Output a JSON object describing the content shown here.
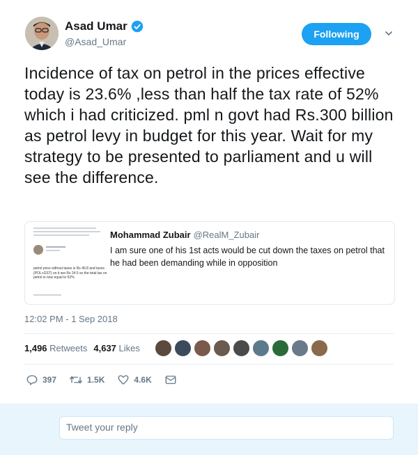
{
  "author": {
    "name": "Asad Umar",
    "handle": "@Asad_Umar",
    "verified": true,
    "follow_button_label": "Following"
  },
  "tweet": {
    "text": "Incidence of tax on petrol in the prices effective today is 23.6% ,less than half the tax rate of 52% which i had criticized.  pml n govt had Rs.300 billion as petrol levy in budget for this year. Wait for my strategy to be presented to parliament and u will see the difference.",
    "timestamp": "12:02 PM - 1 Sep 2018"
  },
  "quoted_tweet": {
    "author_name": "Mohammad Zubair",
    "author_handle": "@RealM_Zubair",
    "text": "I am sure one of his 1st acts would be cut down the taxes on petrol that he had been demanding while in opposition",
    "image_text": "petrol price without taxes is Rs 46.8 and taxes (POL+GST) on it are Rs 24.5 so the total tax on petrol is now equal to 52%"
  },
  "stats": {
    "retweets_count": "1,496",
    "retweets_label": "Retweets",
    "likes_count": "4,637",
    "likes_label": "Likes",
    "liker_colors": [
      "#5a4a3e",
      "#3b4a5c",
      "#7a5a4a",
      "#6b5a50",
      "#4a4a4a",
      "#5c7a8c",
      "#2b6b3a",
      "#6a7a8a",
      "#8a6a4a"
    ]
  },
  "actions": {
    "reply_count": "397",
    "retweet_count": "1.5K",
    "like_count": "4.6K"
  },
  "reply": {
    "placeholder": "Tweet your reply"
  },
  "colors": {
    "accent": "#1da1f2",
    "muted": "#657786"
  }
}
